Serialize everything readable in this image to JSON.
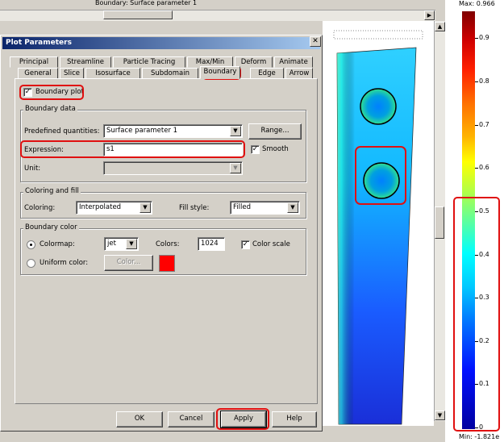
{
  "plot_title": "Boundary: Surface parameter 1",
  "colorbar": {
    "max_label": "Max: 0.966",
    "min_label": "Min: -1.821e",
    "ticks": [
      "0.9",
      "0.8",
      "0.7",
      "0.6",
      "0.5",
      "0.4",
      "0.3",
      "0.2",
      "0.1",
      "0"
    ],
    "colormap": "jet"
  },
  "dialog": {
    "title": "Plot Parameters",
    "close_glyph": "✕",
    "tabs_row1": [
      "Principal",
      "Streamline",
      "Particle Tracing",
      "Max/Min",
      "Deform",
      "Animate"
    ],
    "tabs_row2": [
      "General",
      "Slice",
      "Isosurface",
      "Subdomain",
      "Boundary",
      "Edge",
      "Arrow"
    ],
    "active_tab": "Boundary",
    "boundary_plot_label": "Boundary plot",
    "boundary_plot_checked": true,
    "boundary_data": {
      "group_title": "Boundary data",
      "predefined_label": "Predefined quantities:",
      "predefined_value": "Surface parameter 1",
      "range_button": "Range...",
      "expression_label": "Expression:",
      "expression_value": "s1",
      "smooth_label": "Smooth",
      "smooth_checked": true,
      "unit_label": "Unit:",
      "unit_value": ""
    },
    "coloring_fill": {
      "group_title": "Coloring and fill",
      "coloring_label": "Coloring:",
      "coloring_value": "Interpolated",
      "fill_style_label": "Fill style:",
      "fill_style_value": "Filled"
    },
    "boundary_color": {
      "group_title": "Boundary color",
      "colormap_label": "Colormap:",
      "colormap_value": "jet",
      "colors_label": "Colors:",
      "colors_value": "1024",
      "color_scale_label": "Color scale",
      "color_scale_checked": true,
      "uniform_label": "Uniform color:",
      "color_button": "Color...",
      "uniform_swatch": "#ff0000"
    },
    "buttons": {
      "ok": "OK",
      "cancel": "Cancel",
      "apply": "Apply",
      "help": "Help"
    }
  },
  "colors": {
    "highlight": "#e01010",
    "titlebar": "#0a246a"
  }
}
